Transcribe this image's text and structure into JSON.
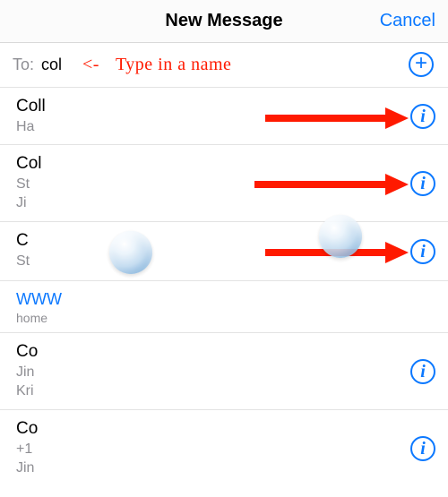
{
  "header": {
    "title": "New Message",
    "cancel": "Cancel"
  },
  "to_row": {
    "label": "To:",
    "value": "col",
    "annotation_arrow": "<-",
    "annotation_text": "Type in a name"
  },
  "suggestions": [
    {
      "title": "Coll",
      "sub": "Ha",
      "has_info": true
    },
    {
      "title": "Col",
      "sub": "St\nJi",
      "has_info": true
    },
    {
      "title": "C",
      "sub": "St",
      "has_info": true
    },
    {
      "link": "WWW",
      "caption": "home",
      "has_info": false
    },
    {
      "title": "Co",
      "sub": "Jin\nKri",
      "has_info": true
    },
    {
      "title": "Co",
      "sub": "+1\nJin",
      "has_info": true
    }
  ],
  "colors": {
    "accent": "#0b78ff",
    "annotation": "#ff1a00"
  }
}
